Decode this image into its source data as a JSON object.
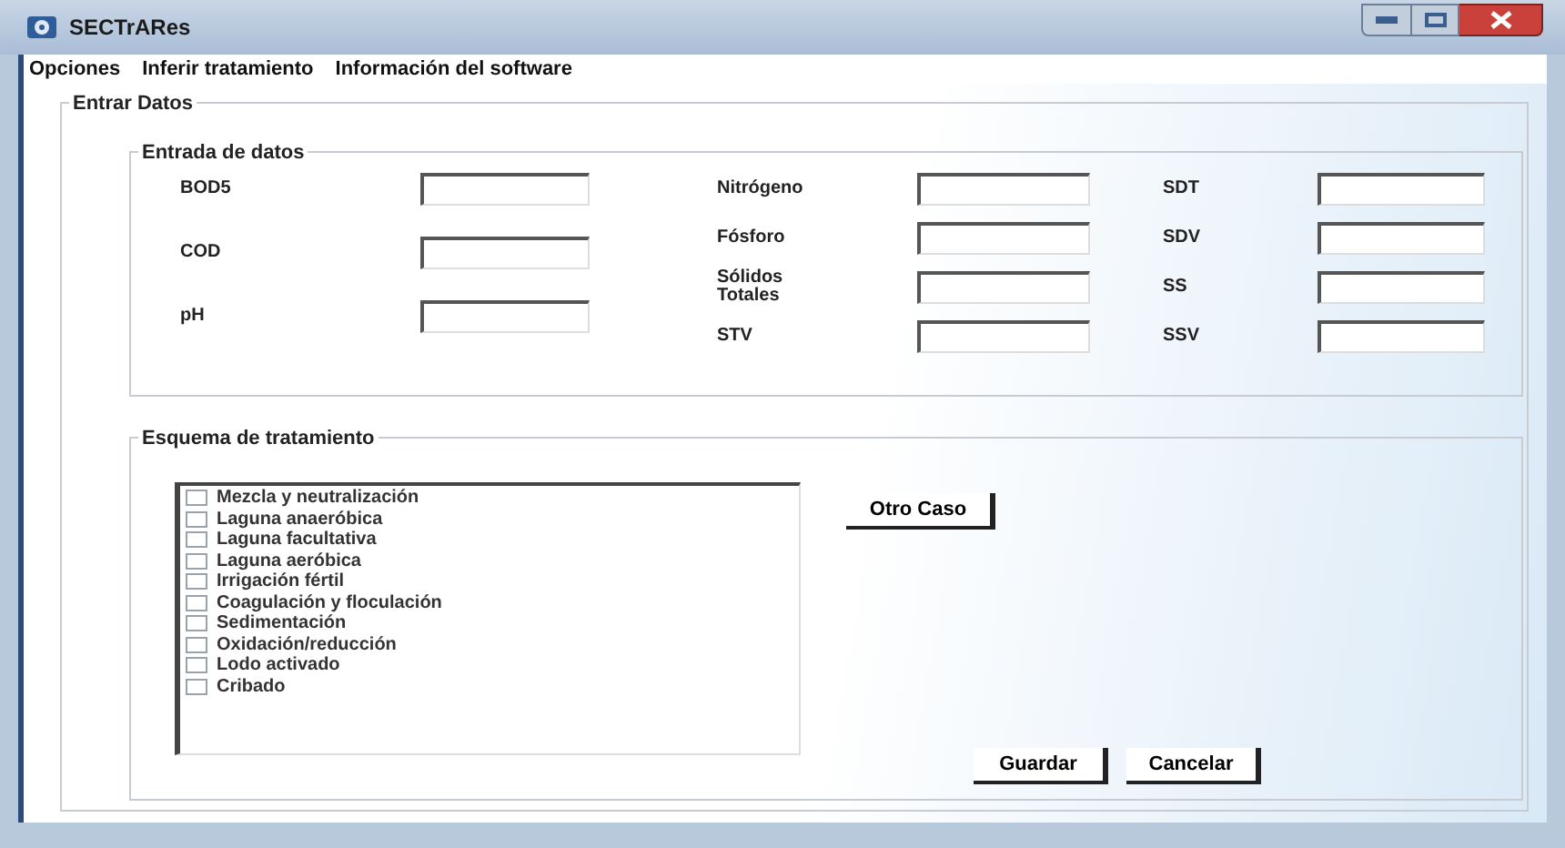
{
  "window": {
    "title": "SECTrARes"
  },
  "menu": [
    {
      "label": "Opciones"
    },
    {
      "label": "Inferir tratamiento"
    },
    {
      "label": "Información del software"
    }
  ],
  "entrar_datos": {
    "title": "Entrar Datos",
    "entrada_de_datos": {
      "title": "Entrada de datos",
      "columns": [
        [
          {
            "label": "BOD5"
          },
          {
            "label": "COD"
          },
          {
            "label": "pH"
          }
        ],
        [
          {
            "label": "Nitrógeno"
          },
          {
            "label": "Fósforo"
          },
          {
            "label": "Sólidos Totales"
          },
          {
            "label": "STV"
          }
        ],
        [
          {
            "label": "SDT"
          },
          {
            "label": "SDV"
          },
          {
            "label": "SS"
          },
          {
            "label": "SSV"
          }
        ]
      ]
    },
    "esquema": {
      "title": "Esquema de tratamiento",
      "items": [
        {
          "label": "Mezcla y neutralización",
          "checked": false
        },
        {
          "label": "Laguna anaeróbica",
          "checked": false
        },
        {
          "label": "Laguna facultativa",
          "checked": false
        },
        {
          "label": "Laguna aeróbica",
          "checked": false
        },
        {
          "label": "Irrigación fértil",
          "checked": false
        },
        {
          "label": "Coagulación y floculación",
          "checked": false
        },
        {
          "label": "Sedimentación",
          "checked": false
        },
        {
          "label": "Oxidación/reducción",
          "checked": false
        },
        {
          "label": "Lodo activado",
          "checked": false
        },
        {
          "label": "Cribado",
          "checked": false
        }
      ],
      "other_button": "Otro Caso",
      "buttons": [
        "Guardar",
        "Cancelar"
      ]
    }
  }
}
